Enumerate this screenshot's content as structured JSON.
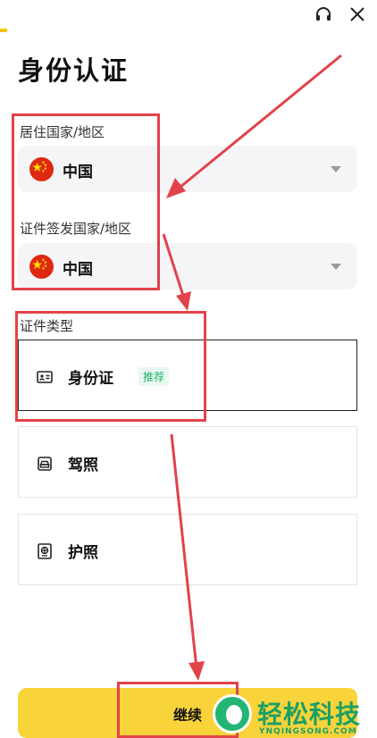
{
  "header": {
    "support_icon": "headset-icon",
    "close_icon": "close-icon",
    "title": "身份认证"
  },
  "residence": {
    "label": "居住国家/地区",
    "value": "中国",
    "flag_icon": "china-flag-icon"
  },
  "issuing": {
    "label": "证件签发国家/地区",
    "value": "中国",
    "flag_icon": "china-flag-icon"
  },
  "id_type": {
    "label": "证件类型",
    "options": [
      {
        "label": "身份证",
        "icon": "id-card-icon",
        "badge": "推荐",
        "selected": true
      },
      {
        "label": "驾照",
        "icon": "car-icon",
        "selected": false
      },
      {
        "label": "护照",
        "icon": "passport-icon",
        "selected": false
      }
    ]
  },
  "continue_label": "继续",
  "colors": {
    "accent": "#f8d33a",
    "annotation": "#e2434a",
    "badge_text": "#20b26b",
    "watermark": "#1c9f64"
  },
  "watermark": {
    "text": "轻松科技",
    "subtext": "YNQINGSONG.COM"
  }
}
